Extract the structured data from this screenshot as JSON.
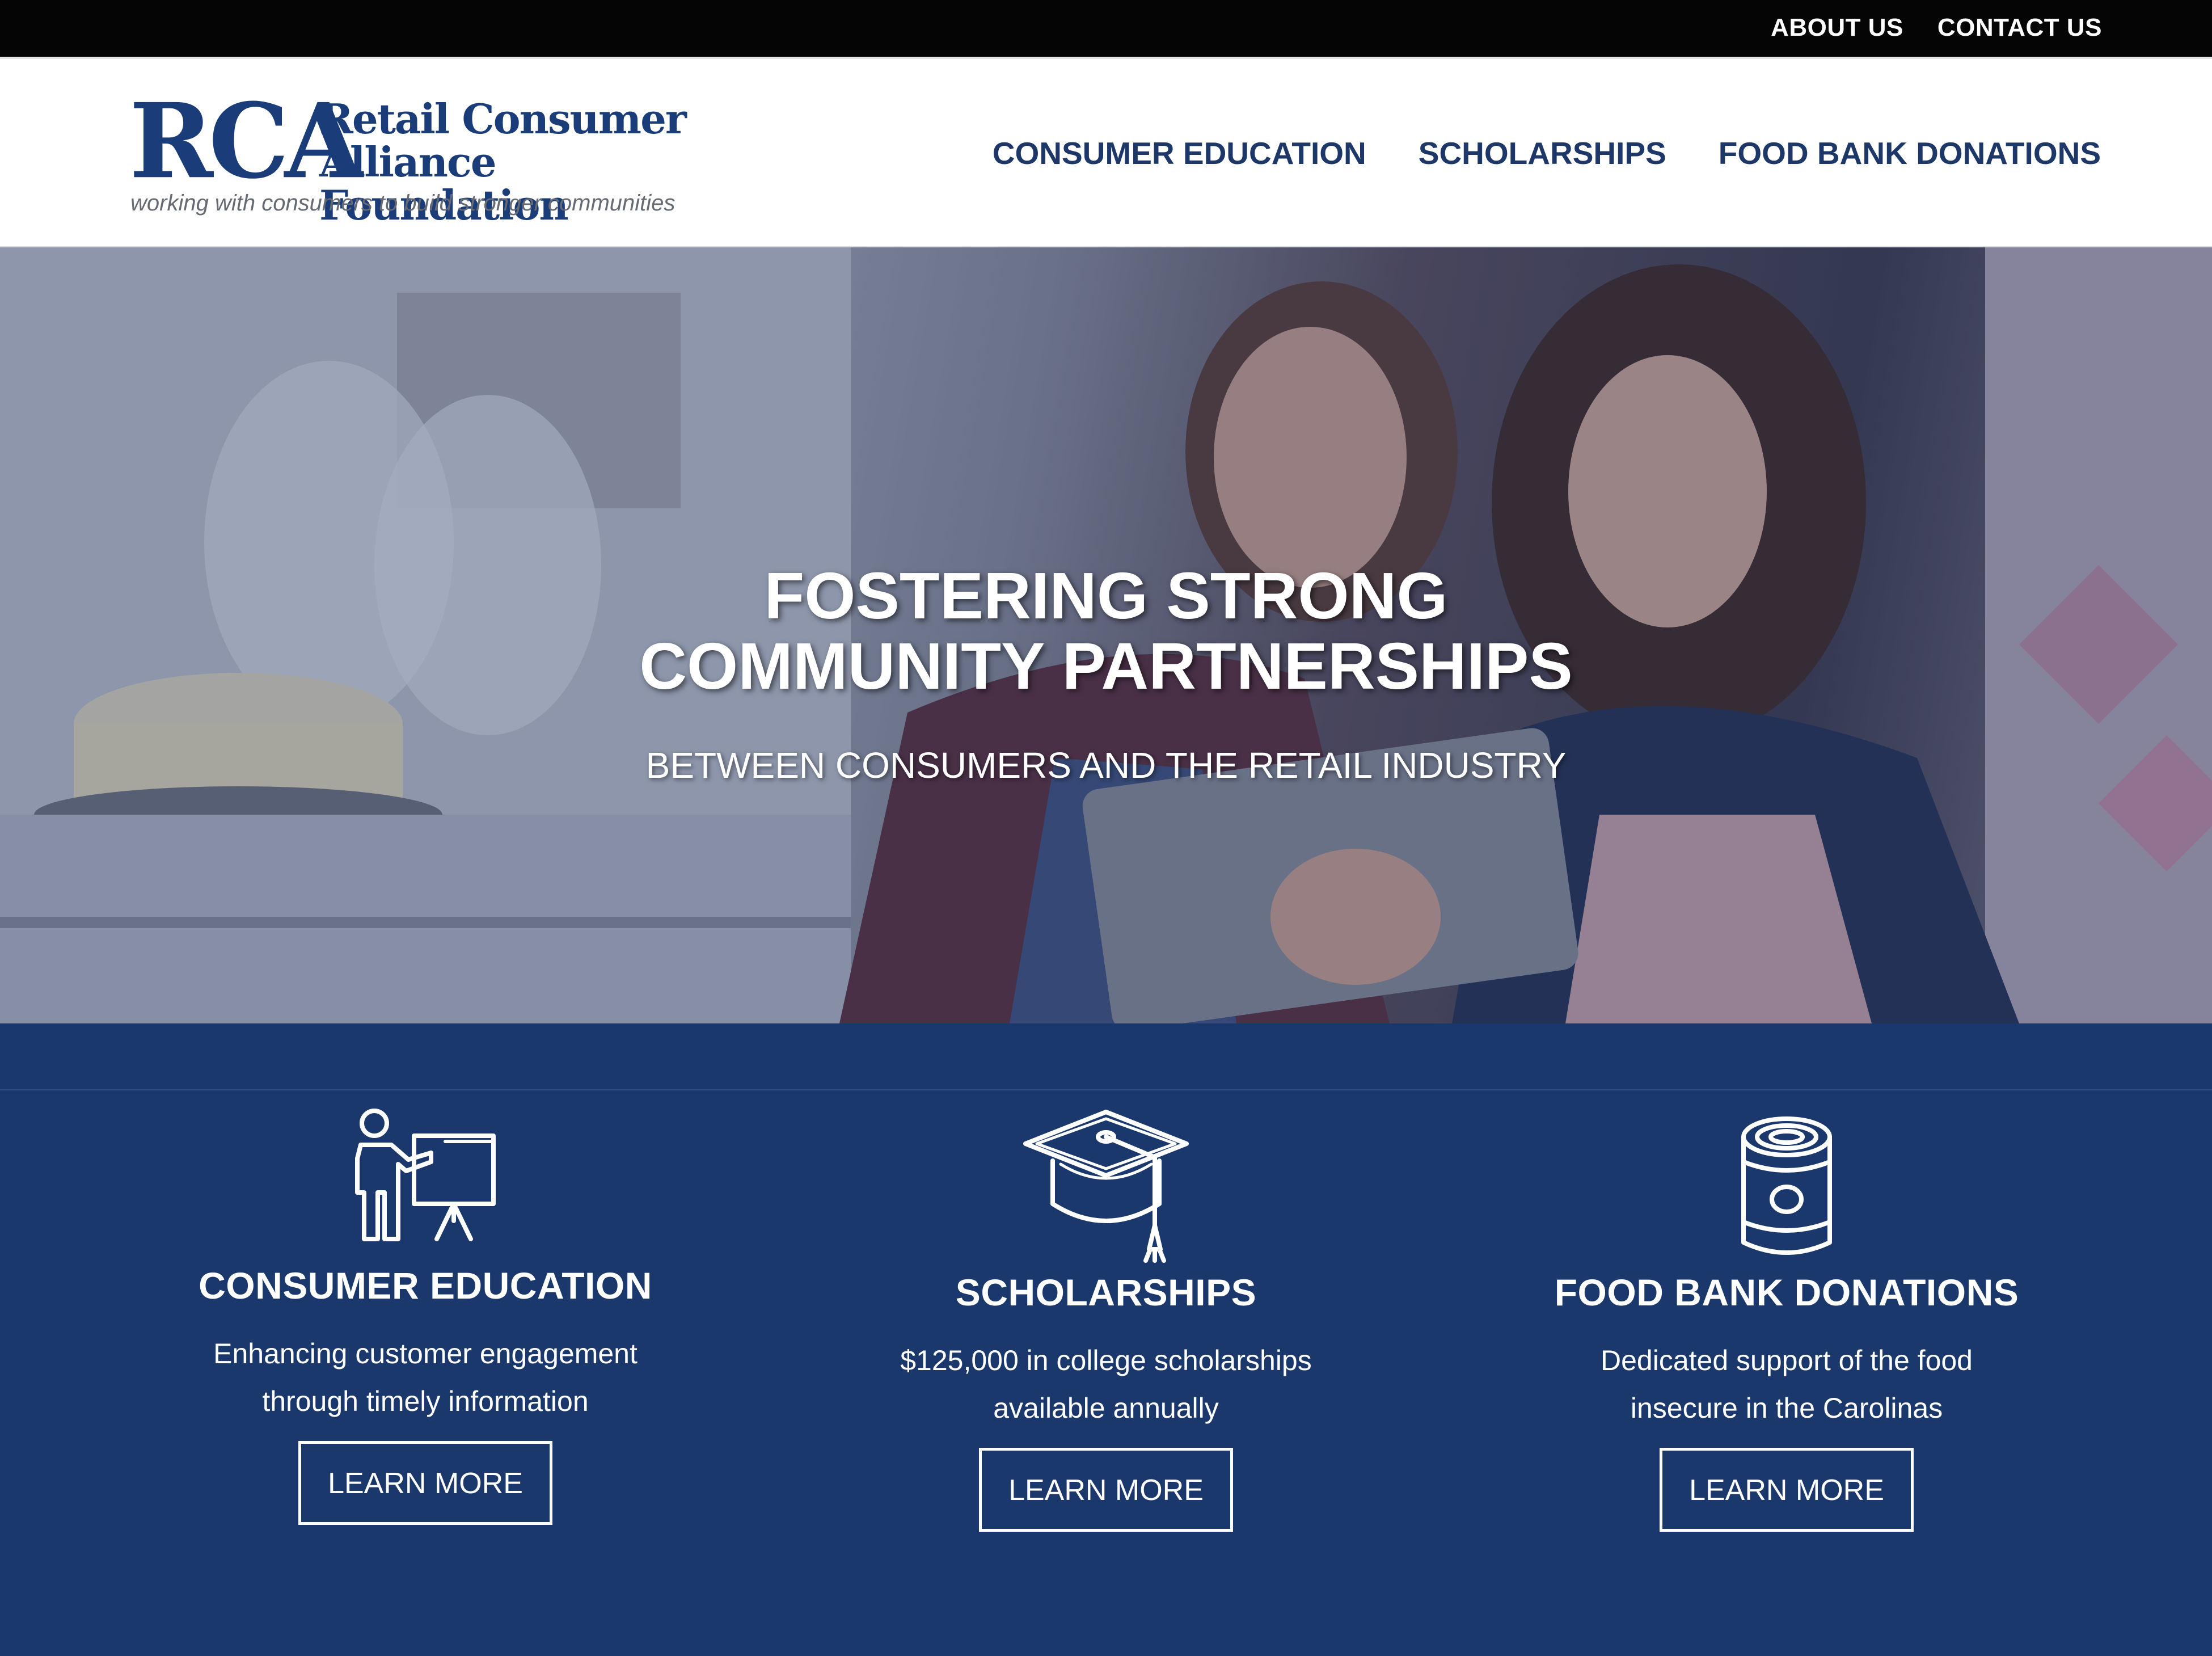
{
  "topbar": {
    "about": "ABOUT US",
    "contact": "CONTACT US"
  },
  "logo": {
    "abbr": "RCA",
    "name_line1": "Retail Consumer",
    "name_line2": "Alliance Foundation",
    "tagline": "working with consumers to build stronger communities"
  },
  "nav": {
    "education": "CONSUMER EDUCATION",
    "scholarships": "SCHOLARSHIPS",
    "food": "FOOD BANK DONATIONS"
  },
  "hero": {
    "title_line1": "FOSTERING STRONG",
    "title_line2": "COMMUNITY PARTNERSHIPS",
    "subtitle": "BETWEEN CONSUMERS AND THE RETAIL INDUSTRY"
  },
  "features": [
    {
      "icon": "presenter-icon",
      "title": "CONSUMER EDUCATION",
      "line1": "Enhancing customer engagement",
      "line2": "through timely information",
      "button": "LEARN MORE"
    },
    {
      "icon": "graduation-cap-icon",
      "title": "SCHOLARSHIPS",
      "line1": "$125,000 in college scholarships",
      "line2": "available annually",
      "button": "LEARN MORE"
    },
    {
      "icon": "food-can-icon",
      "title": "FOOD BANK DONATIONS",
      "line1": "Dedicated support of the food",
      "line2": "insecure in the Carolinas",
      "button": "LEARN MORE"
    }
  ],
  "colors": {
    "brand": "#1a3c78",
    "feature_bg": "#1b386c",
    "topbar": "#050505"
  }
}
